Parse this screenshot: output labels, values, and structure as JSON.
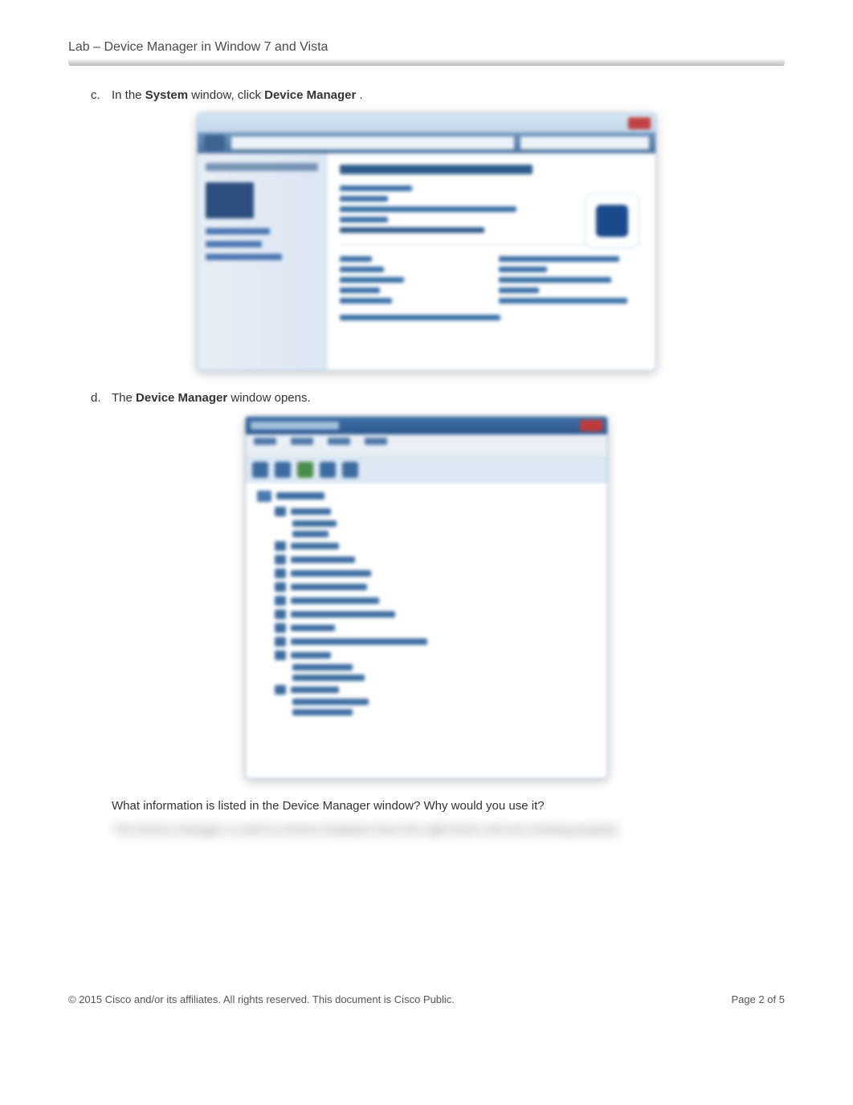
{
  "header": {
    "title": "Lab – Device Manager in Window 7 and Vista"
  },
  "steps": {
    "c": {
      "letter": "c.",
      "text_parts": {
        "p1": "In the ",
        "b1": "System",
        "p2": " window, click ",
        "b2": "Device Manager",
        "p3": "."
      }
    },
    "d": {
      "letter": "d.",
      "text_parts": {
        "p1": "The ",
        "b1": "Device Manager",
        "p2": " window opens."
      }
    }
  },
  "question": "What information is listed in the Device Manager window? Why would you use it?",
  "blurred_answer": "The device manager is used to ensure hardware have the right driver and are working properly.",
  "footer": {
    "copyright": "© 2015 Cisco and/or its affiliates. All rights reserved. This document is Cisco Public.",
    "page_label": "Page ",
    "page_current": "2",
    "page_of": " of ",
    "page_total": "5"
  },
  "screenshots": {
    "system_window": {
      "name": "System",
      "sidebar_heading": "Control Panel Home",
      "link_device_manager": "Device Manager",
      "main_heading": "View basic information about your computer"
    },
    "device_manager_window": {
      "name": "Device Manager",
      "menus": [
        "File",
        "Action",
        "View",
        "Help"
      ],
      "categories": [
        "Batteries",
        "Computer",
        "Disk drives",
        "Display adapters",
        "DVD/CD-ROM drives",
        "Human Interface Devices",
        "IDE ATA/ATAPI controllers",
        "Keyboards",
        "Mice and other pointing devices",
        "Monitors",
        "Network adapters",
        "Ports (COM & LPT)",
        "Processors",
        "Sound, video and game controllers",
        "Storage controllers",
        "System devices",
        "Universal Serial Bus controllers"
      ]
    }
  }
}
